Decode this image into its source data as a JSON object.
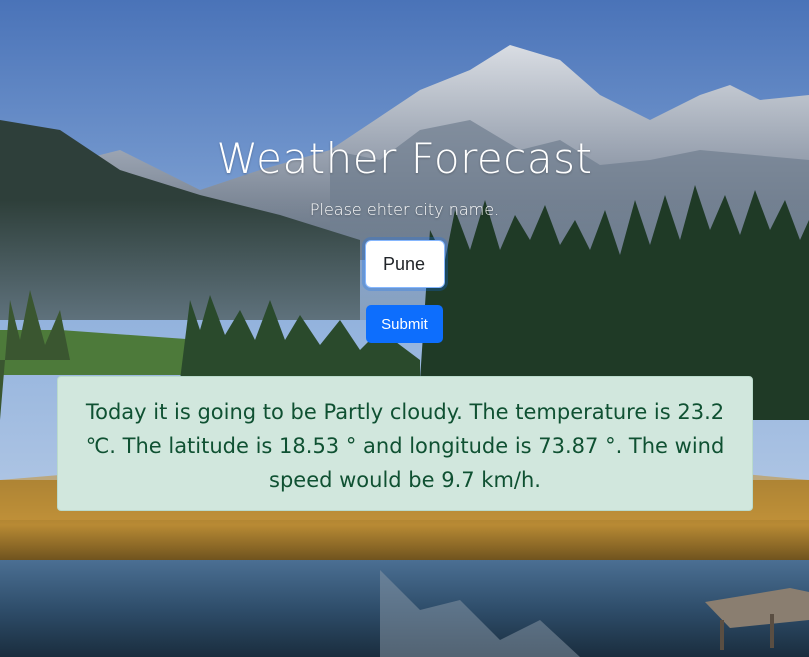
{
  "header": {
    "title": "Weather Forecast",
    "subtitle": "Please ehter city name."
  },
  "form": {
    "city_value": "Pune",
    "submit_label": "Submit"
  },
  "result": {
    "text": "Today it is going to be Partly cloudy. The temperature is 23.2 ℃. The latitude is 18.53 ° and longitude is 73.87 °. The wind speed would be 9.7 km/h."
  },
  "colors": {
    "primary_button": "#0d6efd",
    "alert_bg": "#d1e7dd",
    "alert_text": "#0f5132"
  }
}
